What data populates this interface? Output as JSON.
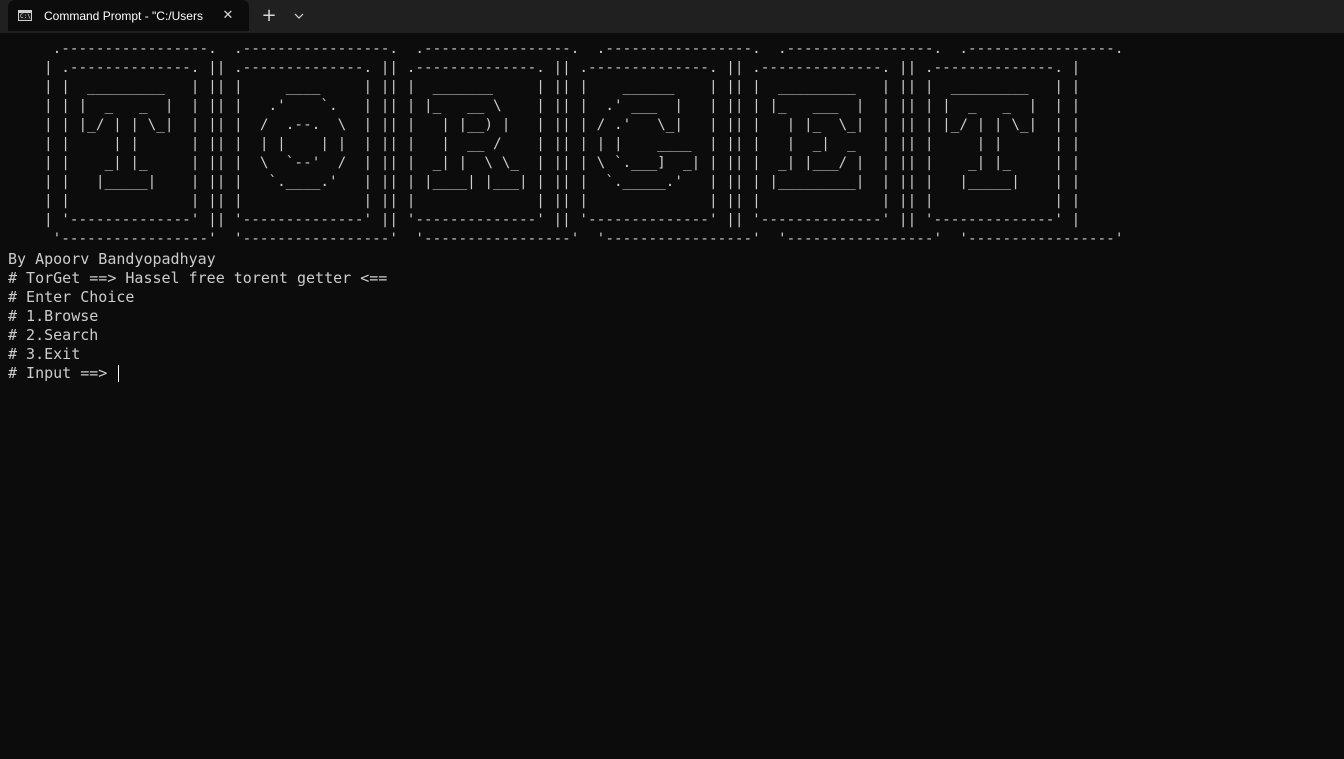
{
  "titlebar": {
    "tab_title": "Command Prompt - \"C:/Users",
    "tab_icon_text": "C:\\",
    "close_glyph": "✕",
    "new_tab_glyph": "+"
  },
  "console": {
    "banner": [
      " .-----------------.  .-----------------.  .-----------------.  .-----------------.  .-----------------.  .-----------------.",
      "| .--------------. || .--------------. || .--------------. || .--------------. || .--------------. || .--------------. |",
      "| |  _________   | || |     ____     | || |  _______     | || |    ______    | || |  _________   | || |  _________   | |",
      "| | |  _   _  |  | || |   .'    `.   | || | |_   __ \\    | || |  .' ___  |   | || | |_   ___  |  | || | |  _   _  |  | |",
      "| | |_/ | | \\_|  | || |  /  .--.  \\  | || |   | |__) |   | || | / .'   \\_|   | || |   | |_  \\_|  | || | |_/ | | \\_|  | |",
      "| |     | |      | || |  | |    | |  | || |   |  __ /    | || | | |    ____  | || |   |  _|  _   | || |     | |      | |",
      "| |    _| |_     | || |  \\  `--'  /  | || |  _| |  \\ \\_  | || | \\ `.___]  _| | || |  _| |___/ |  | || |    _| |_     | |",
      "| |   |_____|    | || |   `.____.'   | || | |____| |___| | || |  `._____.'   | || | |_________|  | || |   |_____|    | |",
      "| |              | || |              | || |              | || |              | || |              | || |              | |",
      "| '--------------' || '--------------' || '--------------' || '--------------' || '--------------' || '--------------' |",
      " '-----------------'  '-----------------'  '-----------------'  '-----------------'  '-----------------'  '-----------------'"
    ],
    "author": "By Apoorv Bandyopadhyay",
    "tagline": "# TorGet ==> Hassel free torent getter <==",
    "prompt_header": "# Enter Choice",
    "options": [
      "# 1.Browse",
      "# 2.Search",
      "# 3.Exit"
    ],
    "input_prompt": "# Input ==> "
  },
  "colors": {
    "background": "#0c0c0c",
    "titlebar": "#202020",
    "text": "#cccccc"
  }
}
